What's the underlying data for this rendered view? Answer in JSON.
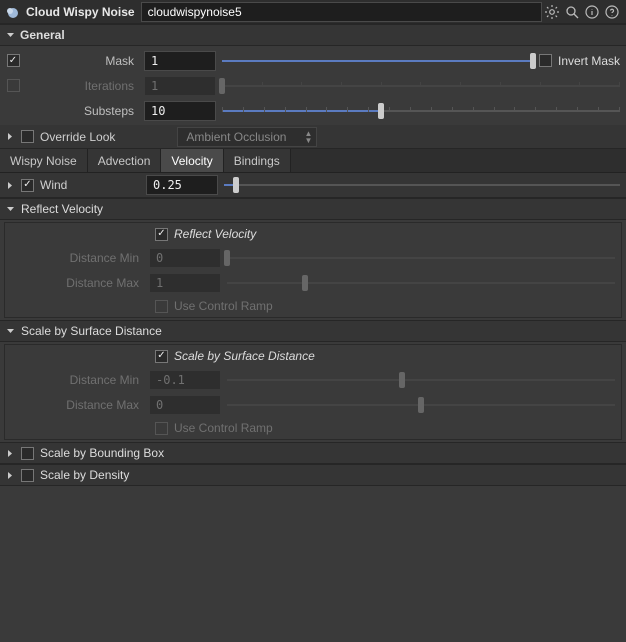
{
  "title": {
    "node_type": "Cloud Wispy Noise",
    "node_name": "cloudwispynoise5"
  },
  "sections": {
    "general": {
      "label": "General",
      "mask": {
        "label": "Mask",
        "value": "1",
        "fill": 100,
        "handle": 100,
        "enabled": true,
        "invert_label": "Invert Mask",
        "invert": false
      },
      "iterations": {
        "label": "Iterations",
        "value": "1",
        "fill": 0,
        "handle": 0,
        "enabled": false
      },
      "substeps": {
        "label": "Substeps",
        "value": "10",
        "fill": 50,
        "handle": 50,
        "enabled": true
      }
    },
    "override": {
      "label": "Override Look",
      "checked": false,
      "preset": "Ambient Occlusion"
    },
    "tabs": [
      "Wispy Noise",
      "Advection",
      "Velocity",
      "Bindings"
    ],
    "active_tab": "Velocity",
    "velocity": {
      "wind": {
        "label": "Wind",
        "checked": true,
        "value": "0.25",
        "fill": 3,
        "handle": 3
      },
      "reflect": {
        "label": "Reflect Velocity",
        "chk_label": "Reflect Velocity",
        "chk": true,
        "dmin": {
          "label": "Distance Min",
          "value": "0",
          "handle": 0
        },
        "dmax": {
          "label": "Distance Max",
          "value": "1",
          "handle": 20
        },
        "ramp_label": "Use Control Ramp",
        "ramp": false
      },
      "scale_surface": {
        "label": "Scale by Surface Distance",
        "chk_label": "Scale by Surface Distance",
        "chk": true,
        "dmin": {
          "label": "Distance Min",
          "value": "-0.1",
          "handle": 45
        },
        "dmax": {
          "label": "Distance Max",
          "value": "0",
          "handle": 50
        },
        "ramp_label": "Use Control Ramp",
        "ramp": false
      },
      "scale_bbox": {
        "label": "Scale by Bounding Box",
        "chk": false
      },
      "scale_density": {
        "label": "Scale by Density",
        "chk": false
      }
    }
  }
}
